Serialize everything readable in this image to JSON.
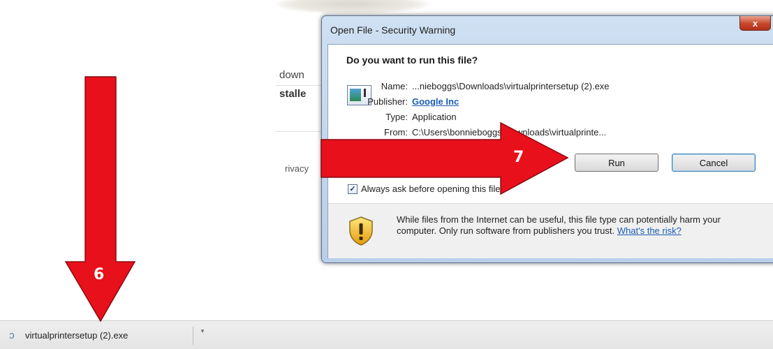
{
  "background": {
    "text_1": "down",
    "text_2": "stalle",
    "text_3": "rivacy"
  },
  "dialog": {
    "title": "Open File - Security Warning",
    "close_glyph": "x",
    "heading": "Do you want to run this file?",
    "fields": [
      {
        "label": "Name:",
        "value": "...nieboggs\\Downloads\\virtualprintersetup (2).exe"
      },
      {
        "label": "Publisher:",
        "value": "Google Inc"
      },
      {
        "label": "Type:",
        "value": "Application"
      },
      {
        "label": "From:",
        "value": "C:\\Users\\bonnieboggs\\Downloads\\virtualprinte..."
      }
    ],
    "run_label": "Run",
    "cancel_label": "Cancel",
    "checkbox_label": "Always ask before opening this file",
    "checkbox_checked": true,
    "warning_text": "While files from the Internet can be useful, this file type can potentially harm your computer. Only run software from publishers you trust.",
    "warning_link": "What's the risk?"
  },
  "download_bar": {
    "file_name": "virtualprintersetup (2).exe"
  },
  "annotations": {
    "step_6": "6",
    "step_7": "7",
    "arrow_color": "#e8101a"
  }
}
